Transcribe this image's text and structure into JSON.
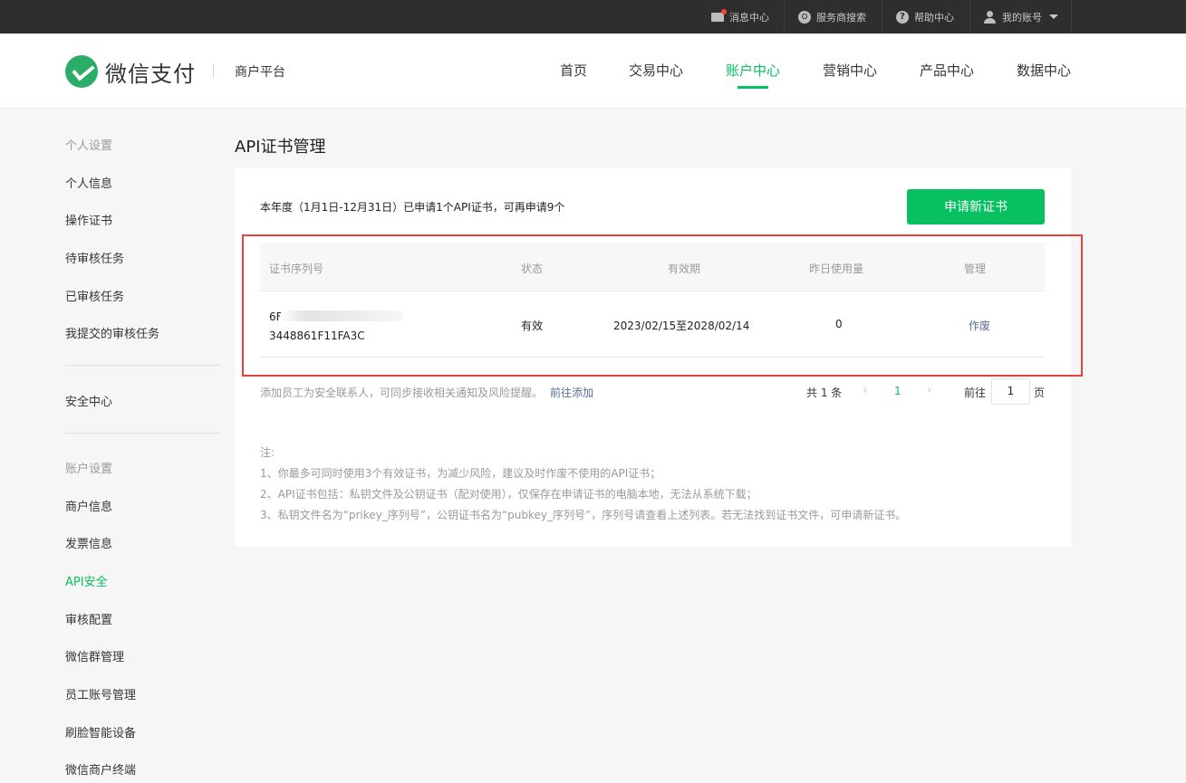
{
  "topbar": {
    "messages": "消息中心",
    "provider_search": "服务商搜索",
    "help": "帮助中心",
    "account": "我的账号"
  },
  "header": {
    "logo_text": "微信支付",
    "platform": "商户平台",
    "nav": [
      "首页",
      "交易中心",
      "账户中心",
      "营销中心",
      "产品中心",
      "数据中心"
    ],
    "active_nav": "账户中心"
  },
  "sidebar": {
    "group_personal": "个人设置",
    "personal_items": [
      "个人信息",
      "操作证书",
      "待审核任务",
      "已审核任务",
      "我提交的审核任务"
    ],
    "security_center": "安全中心",
    "group_account": "账户设置",
    "account_items": [
      "商户信息",
      "发票信息",
      "API安全",
      "审核配置",
      "微信群管理",
      "员工账号管理",
      "刷脸智能设备",
      "微信商户终端"
    ],
    "active_item": "API安全"
  },
  "main": {
    "title": "API证书管理",
    "quota_text": "本年度（1月1日-12月31日）已申请1个API证书，可再申请9个",
    "apply_button": "申请新证书",
    "table": {
      "headers": [
        "证书序列号",
        "状态",
        "有效期",
        "昨日使用量",
        "管理"
      ],
      "rows": [
        {
          "serial_line1": "6F                    F96D9F",
          "serial_line2": "3448861F11FA3C",
          "status": "有效",
          "validity": "2023/02/15至2028/02/14",
          "usage": "0",
          "action": "作废"
        }
      ]
    },
    "footer_tip": "添加员工为安全联系人，可同步接收相关通知及风险提醒。",
    "footer_link": "前往添加",
    "pagination": {
      "total": "共 1 条",
      "prev": "‹",
      "current": "1",
      "next": "›",
      "goto_label": "前往",
      "goto_value": "1",
      "page_unit": "页"
    },
    "notes": {
      "title": "注:",
      "lines": [
        "1、你最多可同时使用3个有效证书，为减少风险，建议及时作废不使用的API证书；",
        "2、API证书包括：私钥文件及公钥证书（配对使用），仅保存在申请证书的电脑本地，无法从系统下载；",
        "3、私钥文件名为“prikey_序列号”，公钥证书名为“pubkey_序列号”，序列号请查看上述列表。若无法找到证书文件，可申请新证书。"
      ]
    }
  },
  "colors": {
    "brand_green": "#07c160",
    "link_blue": "#576b95",
    "highlight_red": "#e8433b",
    "topbar_bg": "#2e2e2e"
  }
}
